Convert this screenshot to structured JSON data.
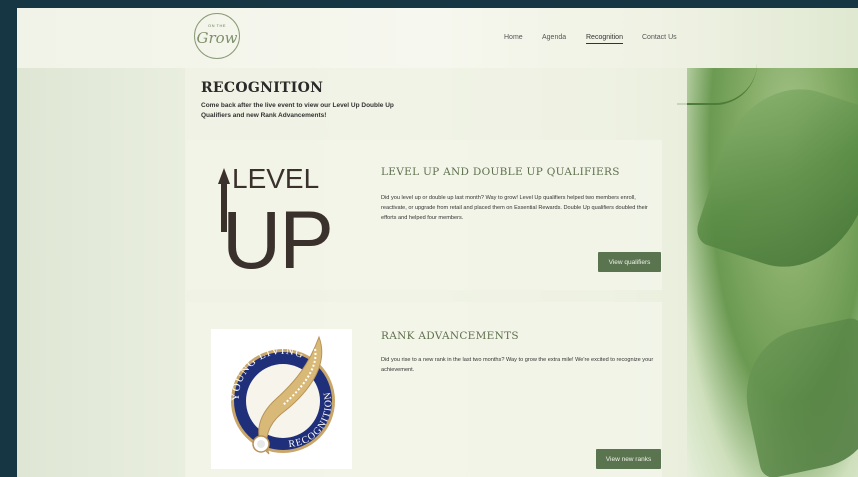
{
  "header": {
    "logo": {
      "small_text": "ON THE",
      "script_text": "Grow"
    },
    "nav": [
      "Home",
      "Agenda",
      "Recognition",
      "Contact Us"
    ],
    "active_nav": "Recognition"
  },
  "page": {
    "title": "RECOGNITION",
    "intro": "Come back after the live event to view our Level Up Double Up Qualifiers and new Rank Advancements!"
  },
  "sections": [
    {
      "image_text_top": "LEVEL",
      "image_text_bottom": "UP",
      "title": "LEVEL UP AND DOUBLE UP QUALIFIERS",
      "body": "Did you level up or double up last month? Way to grow! Level Up qualifiers helped two members enroll, reactivate, or upgrade from retail and placed them on Essential Rewards. Double Up qualifiers doubled their efforts and helped four members.",
      "button": "View qualifiers"
    },
    {
      "image_text_top": "YOUNG LIVING",
      "image_text_bottom": "RECOGNITION",
      "title": "RANK ADVANCEMENTS",
      "body": "Did you rise to a new rank in the last two months? Way to grow the extra mile! We're excited to recognize your achievement.",
      "button": "View new ranks"
    }
  ],
  "colors": {
    "accent": "#5a7450",
    "background": "#173643",
    "heading": "#5e6f4d"
  }
}
